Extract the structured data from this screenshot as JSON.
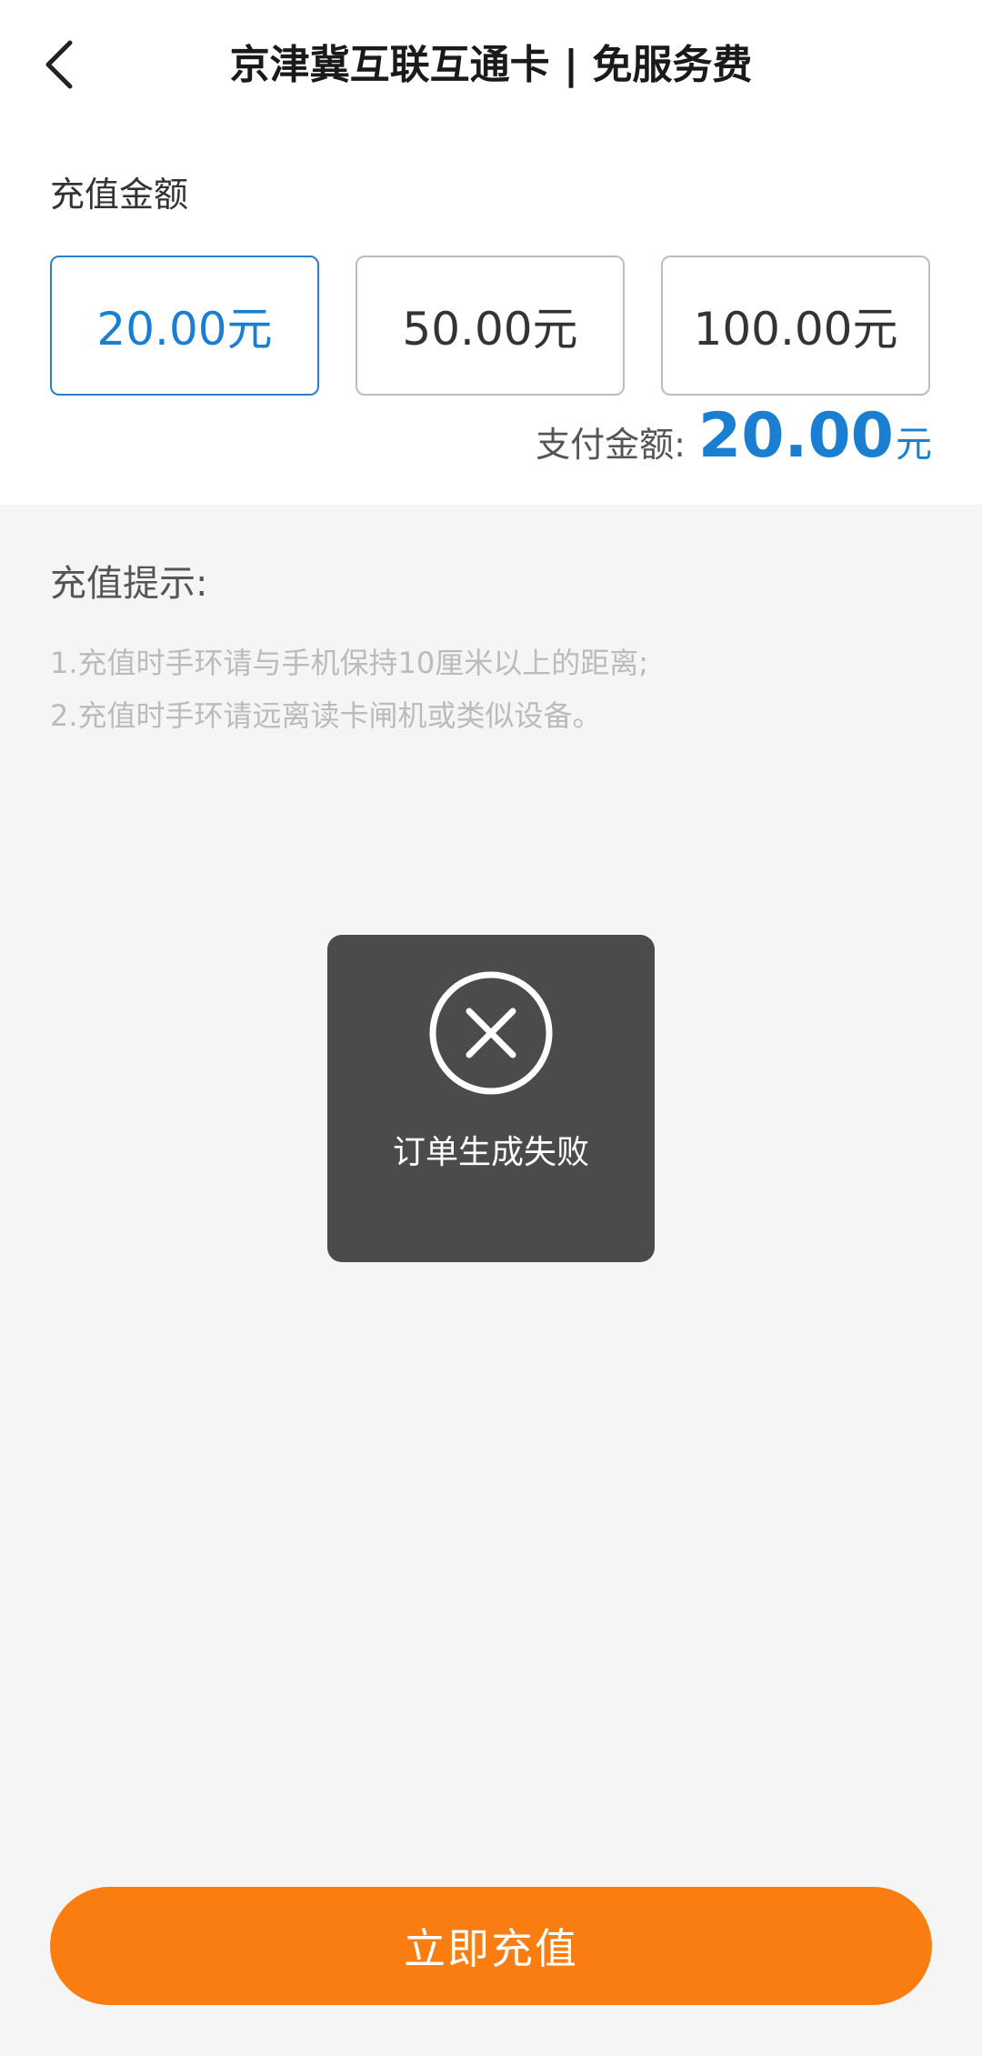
{
  "header": {
    "title": "京津冀互联互通卡 | 免服务费",
    "back_icon": "chevron-left-icon"
  },
  "recharge": {
    "section_label": "充值金额",
    "options": [
      {
        "label": "20.00元",
        "selected": true
      },
      {
        "label": "50.00元",
        "selected": false
      },
      {
        "label": "100.00元",
        "selected": false
      }
    ],
    "pay_label": "支付金额:",
    "pay_amount": "20.00",
    "pay_unit": "元"
  },
  "tips": {
    "title": "充值提示:",
    "items": [
      "1.充值时手环请与手机保持10厘米以上的距离;",
      "2.充值时手环请远离读卡闸机或类似设备。"
    ]
  },
  "toast": {
    "icon": "close-circle-icon",
    "message": "订单生成失败"
  },
  "action": {
    "button_label": "立即充值"
  },
  "colors": {
    "accent_blue": "#1a7fd0",
    "button_orange": "#fa7d12",
    "toast_bg": "#4b4b4b",
    "page_bg": "#f5f5f5"
  }
}
